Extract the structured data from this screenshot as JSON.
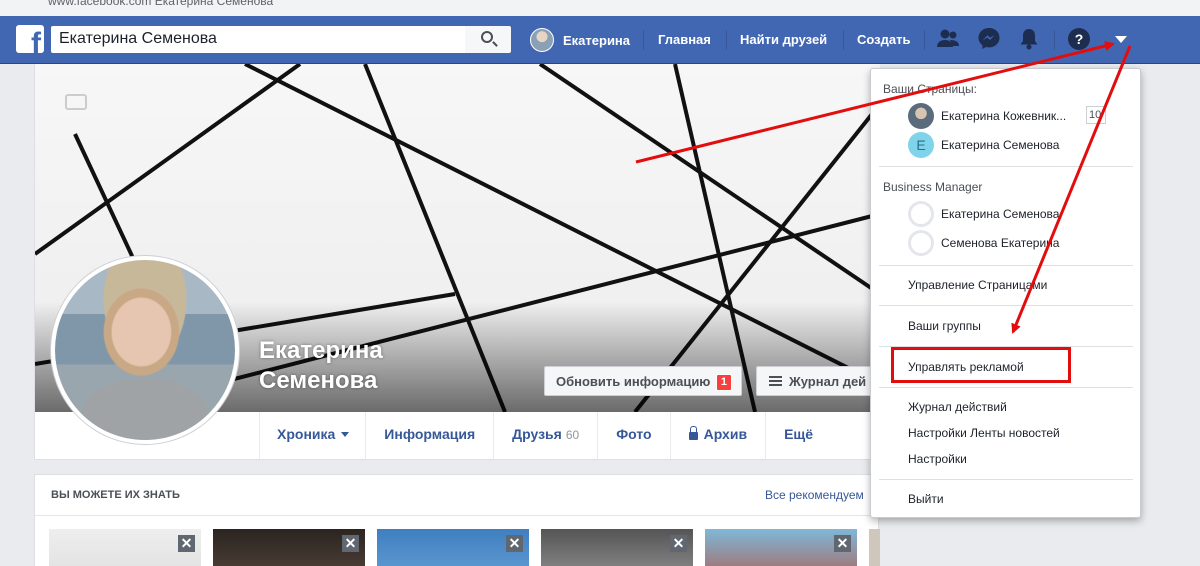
{
  "browser": {
    "url_text": "www.facebook.com   Екатерина Семенова"
  },
  "topbar": {
    "search_value": "Екатерина Семенова",
    "user_name": "Екатерина",
    "nav": [
      "Главная",
      "Найти друзей",
      "Создать"
    ],
    "colors": {
      "bar": "#4267b2",
      "accent_red": "#e20d0d"
    }
  },
  "profile": {
    "name_line1": "Екатерина",
    "name_line2": "Семенова",
    "update_button": "Обновить информацию",
    "update_badge": "1",
    "activity_button": "Журнал дей",
    "tabs": {
      "timeline": "Хроника",
      "info": "Информация",
      "friends": "Друзья",
      "friends_count": "60",
      "photo": "Фото",
      "archive": "Архив",
      "more": "Ещё"
    }
  },
  "pymk": {
    "title": "ВЫ МОЖЕТЕ ИХ ЗНАТЬ",
    "all_link": "Все рекомендуем",
    "close_glyph": "✕"
  },
  "dropdown": {
    "pages_heading": "Ваши Страницы:",
    "pages": [
      {
        "name": "Екатерина Кожевник...",
        "count": "10"
      },
      {
        "name": "Екатерина Семенова",
        "letter": "E"
      }
    ],
    "bm_heading": "Business Manager",
    "bm_accounts": [
      "Екатерина Семенова",
      "Семенова Екатерина"
    ],
    "manage_pages": "Управление Страницами",
    "your_groups": "Ваши группы",
    "manage_ads": "Управлять рекламой",
    "activity_log": "Журнал действий",
    "news_feed_settings": "Настройки Ленты новостей",
    "settings": "Настройки",
    "logout": "Выйти"
  }
}
